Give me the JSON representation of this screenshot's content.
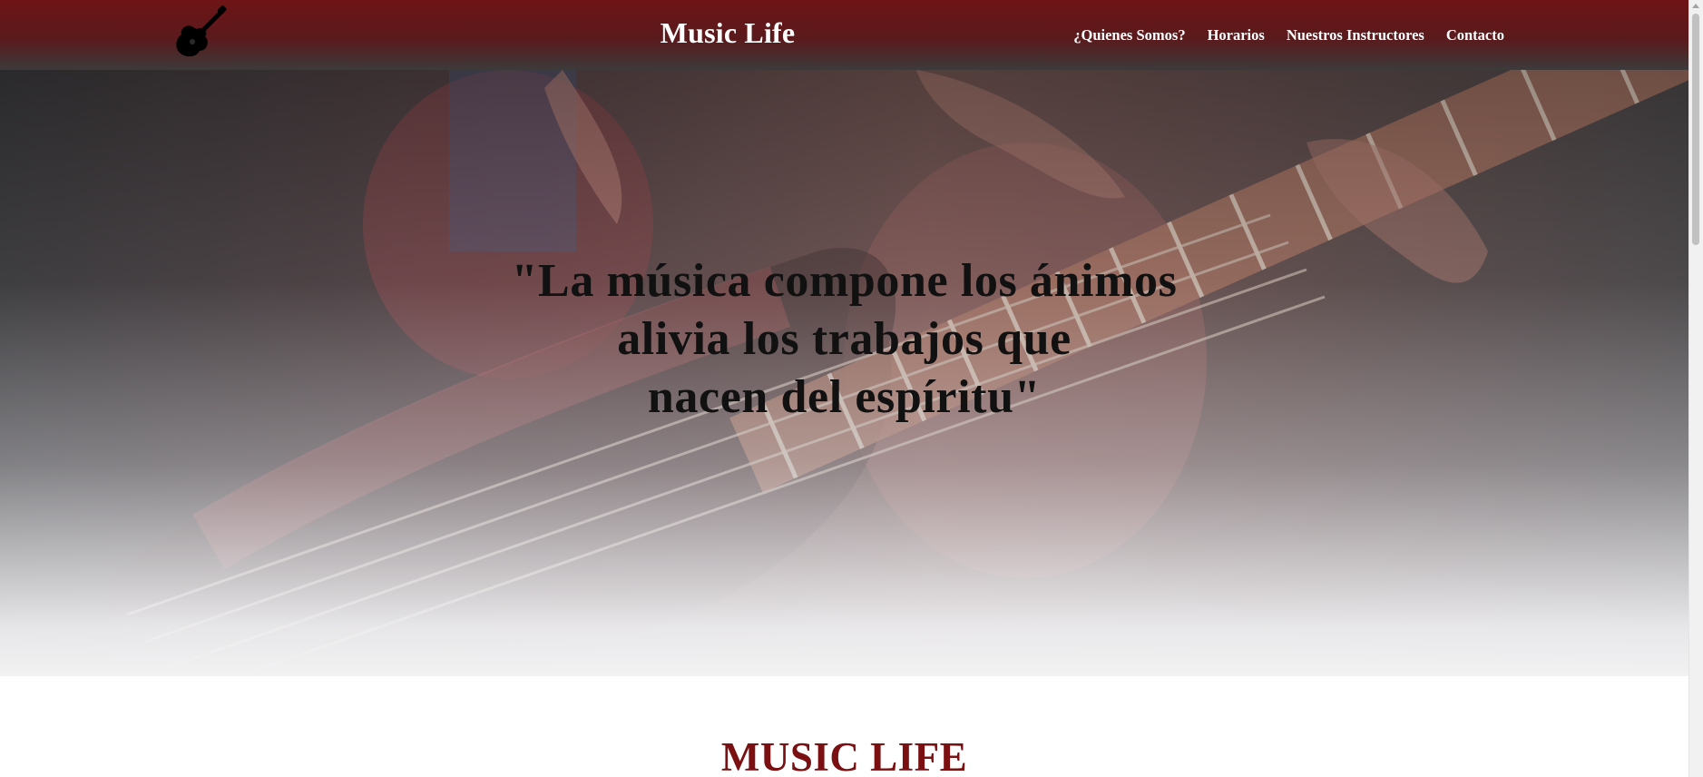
{
  "header": {
    "brand": "Music Life",
    "logo_icon": "guitar-icon",
    "nav": [
      {
        "label": "¿Quienes Somos?"
      },
      {
        "label": "Horarios"
      },
      {
        "label": "Nuestros Instructores"
      },
      {
        "label": "Contacto"
      }
    ]
  },
  "hero": {
    "quote_lines": [
      "\"La música compone los ánimos",
      "alivia los trabajos que",
      "nacen del espíritu\""
    ]
  },
  "section": {
    "title": "MUSIC LIFE"
  },
  "colors": {
    "header_top": "#6e1416",
    "header_bottom": "#3c3a3b",
    "section_title": "#7a1012",
    "quote_text": "#111111"
  }
}
